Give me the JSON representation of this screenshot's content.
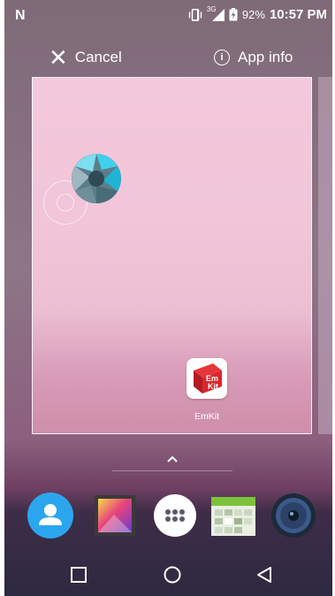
{
  "status_bar": {
    "network_type": "3G",
    "battery_percent": "92%",
    "time": "10:57 PM",
    "icons": [
      "notification-n-icon",
      "vibrate-icon",
      "signal-icon",
      "battery-charging-icon"
    ]
  },
  "actions": {
    "cancel_label": "Cancel",
    "app_info_label": "App info"
  },
  "preview": {
    "apps": [
      {
        "icon": "camera-shutter-icon",
        "label": ""
      },
      {
        "icon": "emkit-app-icon",
        "label": "EmKit"
      }
    ]
  },
  "dock": {
    "items": [
      "contacts-icon",
      "gallery-icon",
      "app-drawer-icon",
      "calendar-icon",
      "music-icon"
    ]
  },
  "nav": {
    "buttons": [
      "recents-button",
      "home-button",
      "back-button"
    ]
  },
  "colors": {
    "accent_blue": "#2196f3",
    "card_pink": "#f2c5d9"
  }
}
